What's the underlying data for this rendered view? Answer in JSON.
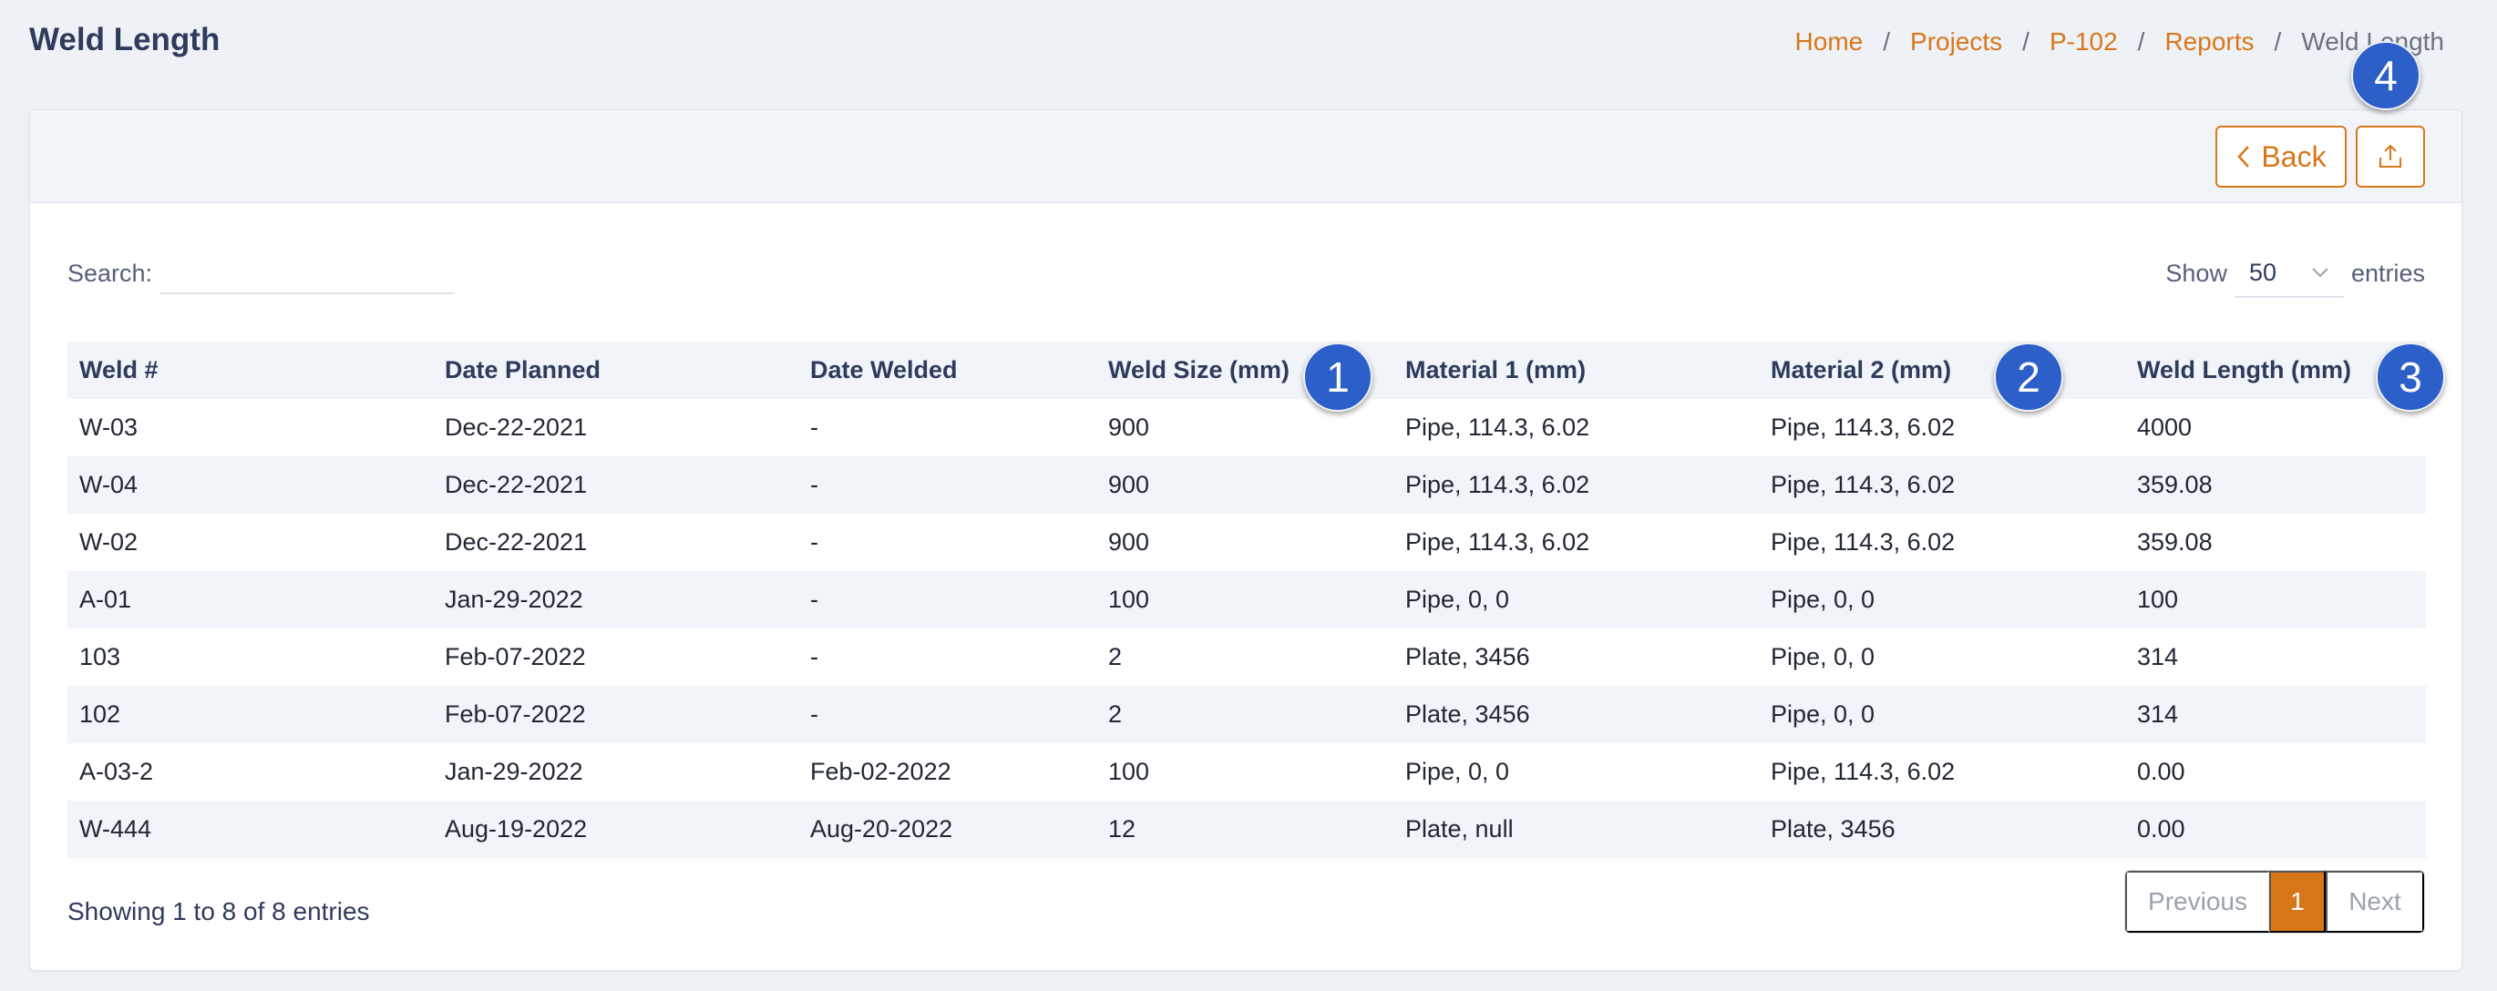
{
  "page": {
    "title": "Weld Length"
  },
  "breadcrumb": [
    {
      "label": "Home",
      "link": true
    },
    {
      "label": "Projects",
      "link": true
    },
    {
      "label": "P-102",
      "link": true
    },
    {
      "label": "Reports",
      "link": true
    },
    {
      "label": "Weld Length",
      "link": false
    }
  ],
  "toolbar": {
    "back_label": "Back",
    "export_icon": "upload-icon"
  },
  "search": {
    "label": "Search:",
    "value": "",
    "placeholder": ""
  },
  "length_menu": {
    "show_label": "Show",
    "value": "50",
    "entries_label": "entries"
  },
  "table": {
    "columns": [
      "Weld #",
      "Date Planned",
      "Date Welded",
      "Weld Size (mm)",
      "Material 1 (mm)",
      "Material 2 (mm)",
      "Weld Length (mm)"
    ],
    "rows": [
      [
        "W-03",
        "Dec-22-2021",
        "-",
        "900",
        "Pipe, 114.3, 6.02",
        "Pipe, 114.3, 6.02",
        "4000"
      ],
      [
        "W-04",
        "Dec-22-2021",
        "-",
        "900",
        "Pipe, 114.3, 6.02",
        "Pipe, 114.3, 6.02",
        "359.08"
      ],
      [
        "W-02",
        "Dec-22-2021",
        "-",
        "900",
        "Pipe, 114.3, 6.02",
        "Pipe, 114.3, 6.02",
        "359.08"
      ],
      [
        "A-01",
        "Jan-29-2022",
        "-",
        "100",
        "Pipe, 0, 0",
        "Pipe, 0, 0",
        "100"
      ],
      [
        "103",
        "Feb-07-2022",
        "-",
        "2",
        "Plate, 3456",
        "Pipe, 0, 0",
        "314"
      ],
      [
        "102",
        "Feb-07-2022",
        "-",
        "2",
        "Plate, 3456",
        "Pipe, 0, 0",
        "314"
      ],
      [
        "A-03-2",
        "Jan-29-2022",
        "Feb-02-2022",
        "100",
        "Pipe, 0, 0",
        "Pipe, 114.3, 6.02",
        "0.00"
      ],
      [
        "W-444",
        "Aug-19-2022",
        "Aug-20-2022",
        "12",
        "Plate, null",
        "Plate, 3456",
        "0.00"
      ]
    ]
  },
  "footer": {
    "info": "Showing 1 to 8 of 8 entries"
  },
  "pagination": {
    "previous": "Previous",
    "current": "1",
    "next": "Next"
  },
  "annotations": [
    "1",
    "2",
    "3",
    "4"
  ],
  "colors": {
    "accent": "#d8771a",
    "badge": "#2d5fc9",
    "title": "#2f3b5c"
  }
}
